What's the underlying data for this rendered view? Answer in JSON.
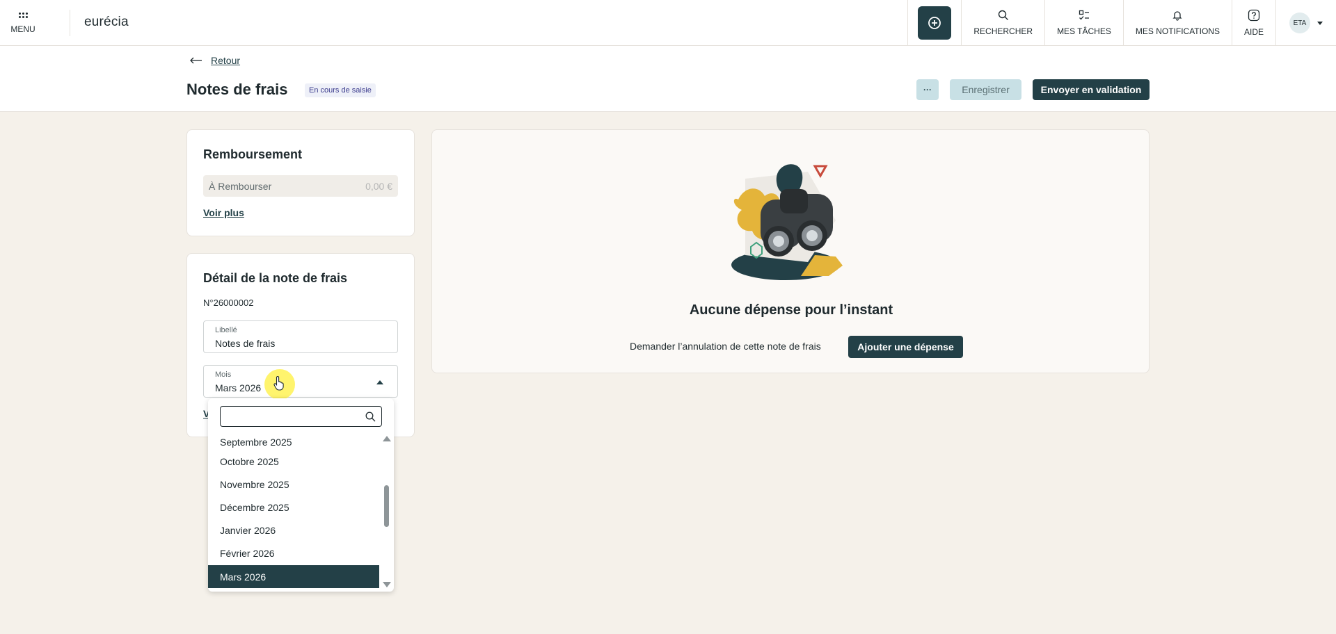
{
  "nav": {
    "menu_label": "MENU",
    "logo": "eurécia",
    "create_icon": "plus-circle-icon",
    "items": [
      {
        "label": "RECHERCHER",
        "icon": "search-icon"
      },
      {
        "label": "MES TÂCHES",
        "icon": "tasks-icon"
      },
      {
        "label": "MES NOTIFICATIONS",
        "icon": "bell-icon"
      },
      {
        "label": "AIDE",
        "icon": "help-icon"
      }
    ],
    "avatar": "ETA"
  },
  "header": {
    "back_label": "Retour",
    "title": "Notes de frais",
    "status_badge": "En cours de saisie",
    "more_label": "···",
    "save_label": "Enregistrer",
    "send_label": "Envoyer en validation"
  },
  "remboursement": {
    "title": "Remboursement",
    "row_label": "À Rembourser",
    "row_amount": "0,00 €",
    "see_more": "Voir plus"
  },
  "detail": {
    "title": "Détail de la note de frais",
    "numero": "N°26000002",
    "libelle_label": "Libellé",
    "libelle_value": "Notes de frais",
    "mois_label": "Mois",
    "mois_value": "Mars 2026",
    "hidden_link": "V"
  },
  "dropdown": {
    "search_value": "",
    "options": [
      "Septembre 2025",
      "Octobre 2025",
      "Novembre 2025",
      "Décembre 2025",
      "Janvier 2026",
      "Février 2026",
      "Mars 2026"
    ],
    "selected": "Mars 2026"
  },
  "empty_state": {
    "title": "Aucune dépense pour l’instant",
    "cancel_link": "Demander l’annulation de cette note de frais",
    "add_button": "Ajouter une dépense"
  },
  "colors": {
    "primary": "#234047",
    "secondary_button": "#c8e0e5",
    "page_background": "#f5f1ea",
    "badge_text": "#3a3a8c",
    "cursor_highlight": "#fff03c"
  }
}
